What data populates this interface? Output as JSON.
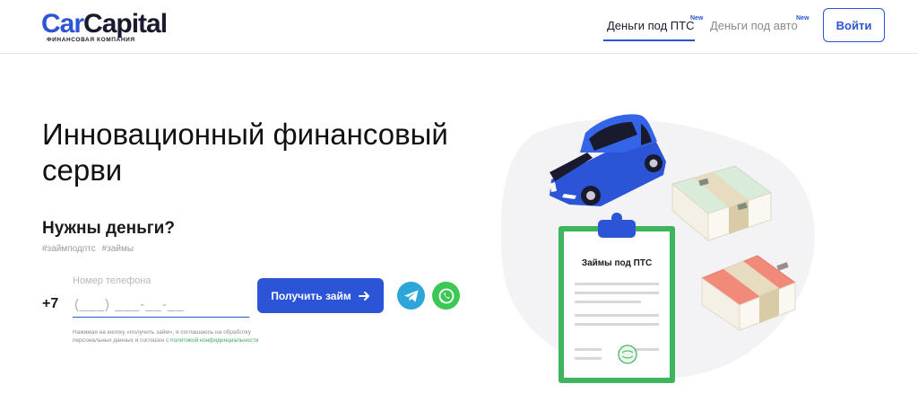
{
  "header": {
    "logo": {
      "car": "Car",
      "capital": "Capital",
      "subtitle": "ФИНАНСОВАЯ КОМПАНИЯ"
    },
    "nav": [
      {
        "label": "Деньги под ПТС",
        "badge": "New",
        "active": true
      },
      {
        "label": "Деньги под авто",
        "badge": "New",
        "active": false
      }
    ],
    "login_label": "Войти"
  },
  "hero": {
    "title": "Инновационный финансовый серви",
    "subtitle": "Нужны деньги?",
    "tags": [
      "#займподптс",
      "#займы"
    ]
  },
  "form": {
    "phone_label": "Номер телефона",
    "phone_prefix": "+7",
    "phone_placeholder": "(___) ___-__-__",
    "submit_label": "Получить займ",
    "consent_text": "Нажимая на кнопку «получить займ», я соглашаюсь на обработку персональных данных и согласен с ",
    "consent_link": "политикой конфиденциальности"
  },
  "illustration": {
    "clipboard_title": "Займы под ПТС"
  },
  "colors": {
    "accent": "#2b54d6",
    "telegram": "#2ea5d9",
    "whatsapp": "#3dc754",
    "clipboard_green": "#3fb45e"
  },
  "icons": {
    "submit": "arrow-right-icon",
    "telegram": "telegram-icon",
    "whatsapp": "whatsapp-icon"
  }
}
